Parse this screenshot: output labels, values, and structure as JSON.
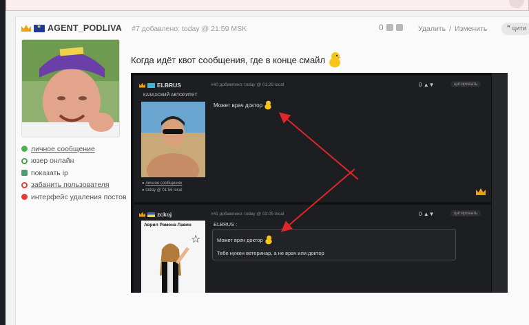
{
  "post": {
    "author": "AGENT_PODLIVA",
    "meta": "#7 добавлено: today @ 21:59 MSK",
    "score": "0",
    "delete_label": "Удалить",
    "separator": "/",
    "edit_label": "Изменить",
    "quote_label": "цити",
    "title": "Когда идёт квот сообщения, где в конце смайл"
  },
  "sidebar": {
    "items": [
      {
        "label": "личное сообщение",
        "color": "#4caf50"
      },
      {
        "label": "юзер онлайн",
        "color": "#43a047"
      },
      {
        "label": "показать ip",
        "color": "#4a9e77"
      },
      {
        "label": "забанить пользователя",
        "color": "#e53935"
      },
      {
        "label": "интерфейс удаления постов",
        "color": "#e53935"
      }
    ]
  },
  "screenshot": {
    "post1": {
      "author": "ELBRUS",
      "meta": "#40 добавлено: today @ 01:29 local",
      "score": "0",
      "quote": "цитировать",
      "rank": "КАЗАХСКИЙ АВТОРИТЕТ",
      "text": "Может врач доктор",
      "link1": "личное сообщение",
      "link2": "today @ 01:56 local"
    },
    "post2": {
      "author": "zckoj",
      "meta": "#41 добавлено: today @ 02:05 local",
      "score": "0",
      "quote": "цитировать",
      "poster_title": "Аврил Рамона Лавин",
      "quote_author": "ELBRUS :",
      "quoted_text": "Может врач доктор",
      "reply": "Тебе нужен ветеринар, а не врач или доктор"
    }
  }
}
